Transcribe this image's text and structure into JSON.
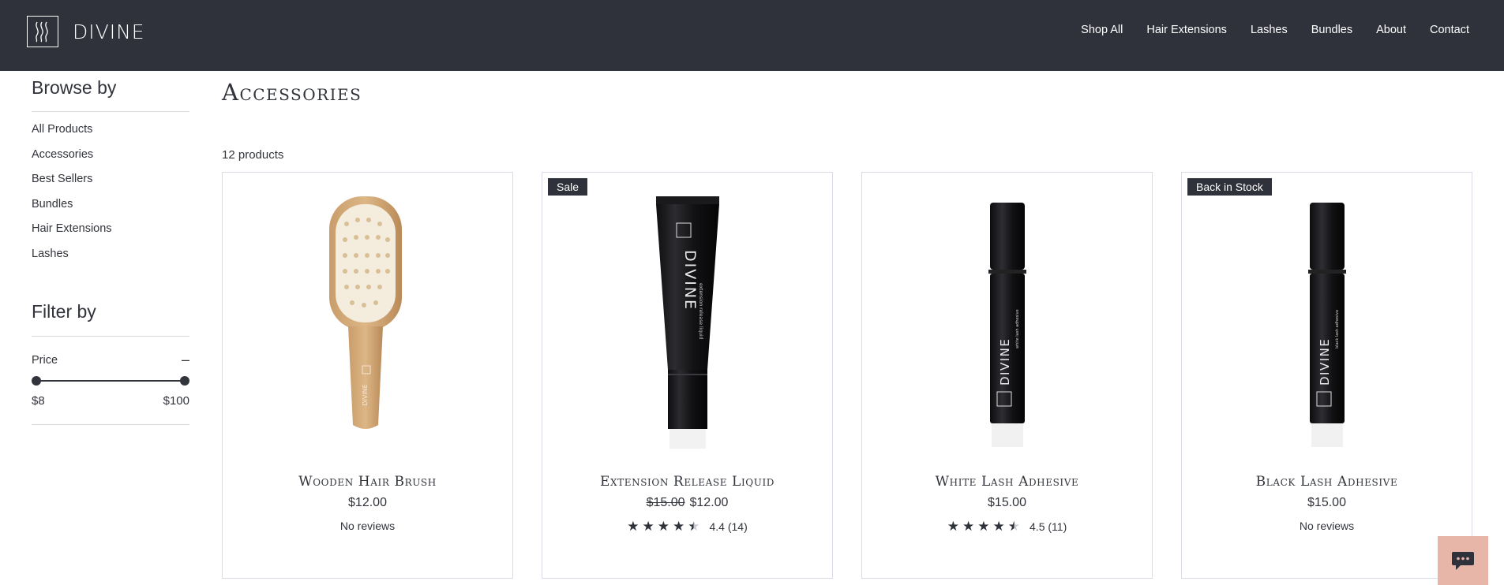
{
  "header": {
    "logo_text": "DIVINE",
    "nav": [
      "Shop All",
      "Hair Extensions",
      "Lashes",
      "Bundles",
      "About",
      "Contact"
    ]
  },
  "sidebar": {
    "browse_heading": "Browse by",
    "browse_items": [
      "All Products",
      "Accessories",
      "Best Sellers",
      "Bundles",
      "Hair Extensions",
      "Lashes"
    ],
    "filter_heading": "Filter by",
    "price_label": "Price",
    "price_toggle": "–",
    "price_min": "$8",
    "price_max": "$100"
  },
  "main": {
    "title": "Accessories",
    "product_count": "12 products",
    "products": [
      {
        "name": "Wooden Hair Brush",
        "price": "$12.00",
        "old_price": "",
        "badge": "",
        "rating": "",
        "review_count": "",
        "reviews_text": "No reviews",
        "icon": "hair-brush-icon"
      },
      {
        "name": "Extension Release Liquid",
        "price": "$12.00",
        "old_price": "$15.00",
        "badge": "Sale",
        "rating": "4.4",
        "review_count": "(14)",
        "reviews_text": "",
        "icon": "tube-icon"
      },
      {
        "name": "White Lash Adhesive",
        "price": "$15.00",
        "old_price": "",
        "badge": "",
        "rating": "4.5",
        "review_count": "(11)",
        "reviews_text": "",
        "icon": "adhesive-bottle-icon"
      },
      {
        "name": "Black Lash Adhesive",
        "price": "$15.00",
        "old_price": "",
        "badge": "Back in Stock",
        "rating": "",
        "review_count": "",
        "reviews_text": "No reviews",
        "icon": "adhesive-bottle-icon"
      }
    ]
  },
  "product_brand_text": "DIVINE",
  "tube_label": "extension release liquid",
  "white_bottle_label": "white lash adhesive",
  "black_bottle_label": "black lash adhesive",
  "colors": {
    "header_bg": "#30323b",
    "text": "#32343b",
    "card_border": "#d9dbe6",
    "chat_bg": "#e8b5a9"
  }
}
